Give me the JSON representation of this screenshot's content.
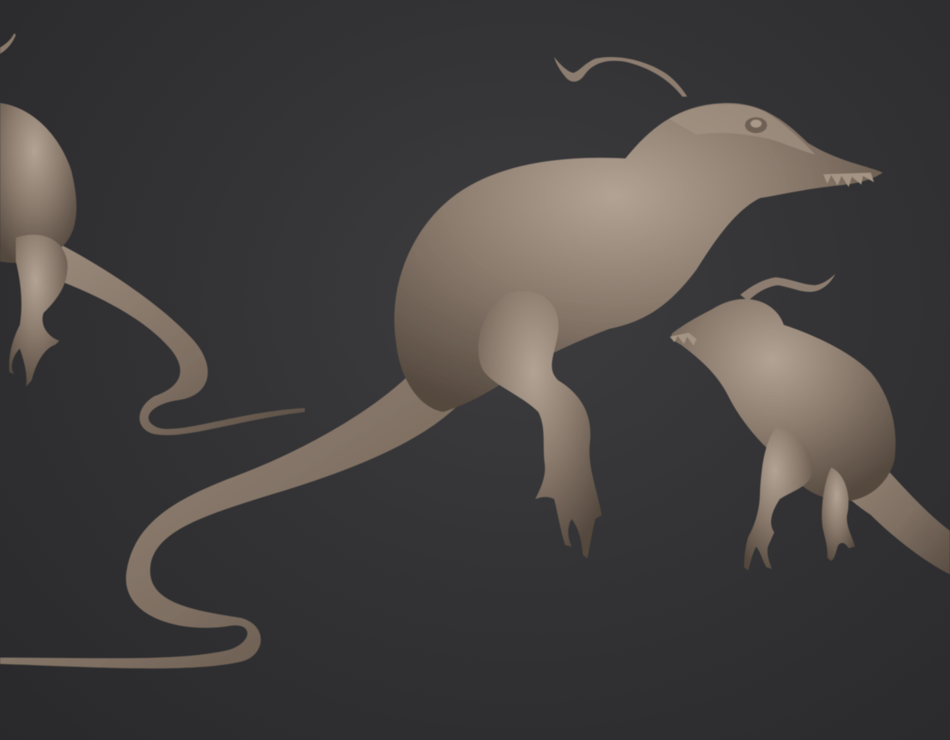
{
  "scene": {
    "background_color": "#333335",
    "clay_color": "#8a7a6c",
    "clay_highlight": "#b3a394",
    "clay_shadow": "#54483e",
    "subject": "sculpted-creature-model",
    "views": [
      "left-side-view",
      "main-three-quarter-view",
      "front-right-view"
    ]
  }
}
